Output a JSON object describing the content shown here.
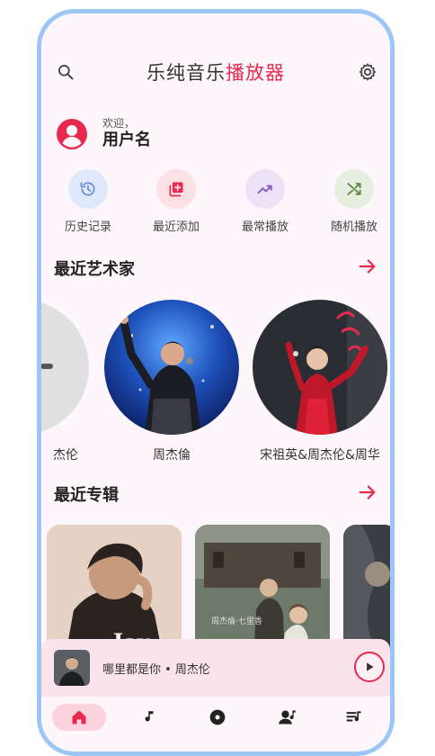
{
  "app": {
    "title_main": "乐纯音乐",
    "title_accent": "播放器"
  },
  "user": {
    "welcome": "欢迎，",
    "name": "用户名"
  },
  "quick_actions": [
    {
      "label": "历史记录",
      "icon": "history-icon",
      "color": "#dfe9fb"
    },
    {
      "label": "最近添加",
      "icon": "add-library-icon",
      "color": "#fbe0e4"
    },
    {
      "label": "最常播放",
      "icon": "trending-icon",
      "color": "#ece3f7"
    },
    {
      "label": "随机播放",
      "icon": "shuffle-icon",
      "color": "#e6efdf"
    }
  ],
  "sections": {
    "artists_title": "最近艺术家",
    "albums_title": "最近专辑"
  },
  "artists": [
    {
      "name": "杰伦"
    },
    {
      "name": "周杰倫"
    },
    {
      "name": "宋祖英&周杰伦&周华"
    }
  ],
  "now_playing": {
    "text": "哪里都是你 • 周杰伦"
  },
  "colors": {
    "accent": "#e8294f",
    "frame": "#9cc7f5",
    "background": "#fdf7fb"
  }
}
